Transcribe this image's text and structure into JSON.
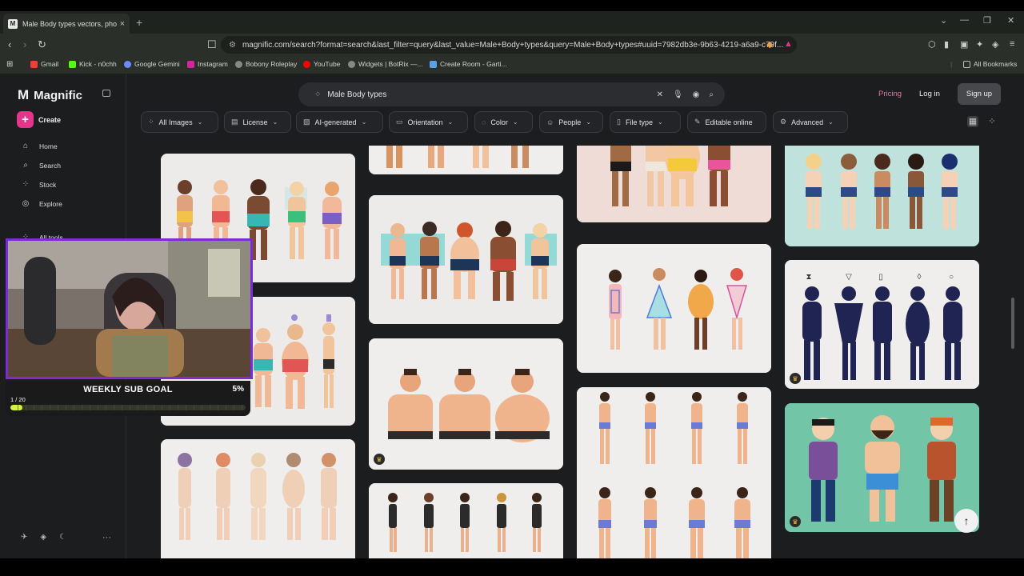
{
  "browser": {
    "tab_title": "Male Body types vectors, photo",
    "url": "magnific.com/search?format=search&last_filter=query&last_value=Male+Body+types&query=Male+Body+types#uuid=7982db3e-9b63-4219-a6a9-c79f...",
    "bookmarks": [
      "Gmail",
      "Kick - n0chh",
      "Google Gemini",
      "Instagram",
      "Bobony Roleplay",
      "YouTube",
      "Widgets | BotRix —...",
      "Create Room - Garti..."
    ],
    "all_bookmarks": "All Bookmarks"
  },
  "sidebar": {
    "brand": "Magnific",
    "create": "Create",
    "items": [
      {
        "label": "Home",
        "icon": "home-icon"
      },
      {
        "label": "Search",
        "icon": "search-icon"
      },
      {
        "label": "Stock",
        "icon": "grid-icon"
      },
      {
        "label": "Explore",
        "icon": "compass-icon"
      },
      {
        "label": "All tools",
        "icon": "apps-icon"
      }
    ]
  },
  "header": {
    "search_value": "Male Body types",
    "pricing": "Pricing",
    "login": "Log in",
    "signup": "Sign up"
  },
  "filters": [
    {
      "label": "All Images",
      "icon": "images-icon"
    },
    {
      "label": "License",
      "icon": "license-icon"
    },
    {
      "label": "AI-generated",
      "icon": "ai-icon"
    },
    {
      "label": "Orientation",
      "icon": "orientation-icon"
    },
    {
      "label": "Color",
      "icon": "palette-icon"
    },
    {
      "label": "People",
      "icon": "people-icon"
    },
    {
      "label": "File type",
      "icon": "file-icon"
    },
    {
      "label": "Editable online",
      "icon": "pencil-icon"
    },
    {
      "label": "Advanced",
      "icon": "sliders-icon"
    }
  ],
  "sub_goal": {
    "title": "WEEKLY SUB GOAL",
    "percent_label": "5%",
    "count": "1 / 20",
    "progress": 0.05
  },
  "colors": {
    "accent": "#e5358a",
    "goal_border": "#7b2bd8",
    "goal_fill": "#d7f23a"
  }
}
